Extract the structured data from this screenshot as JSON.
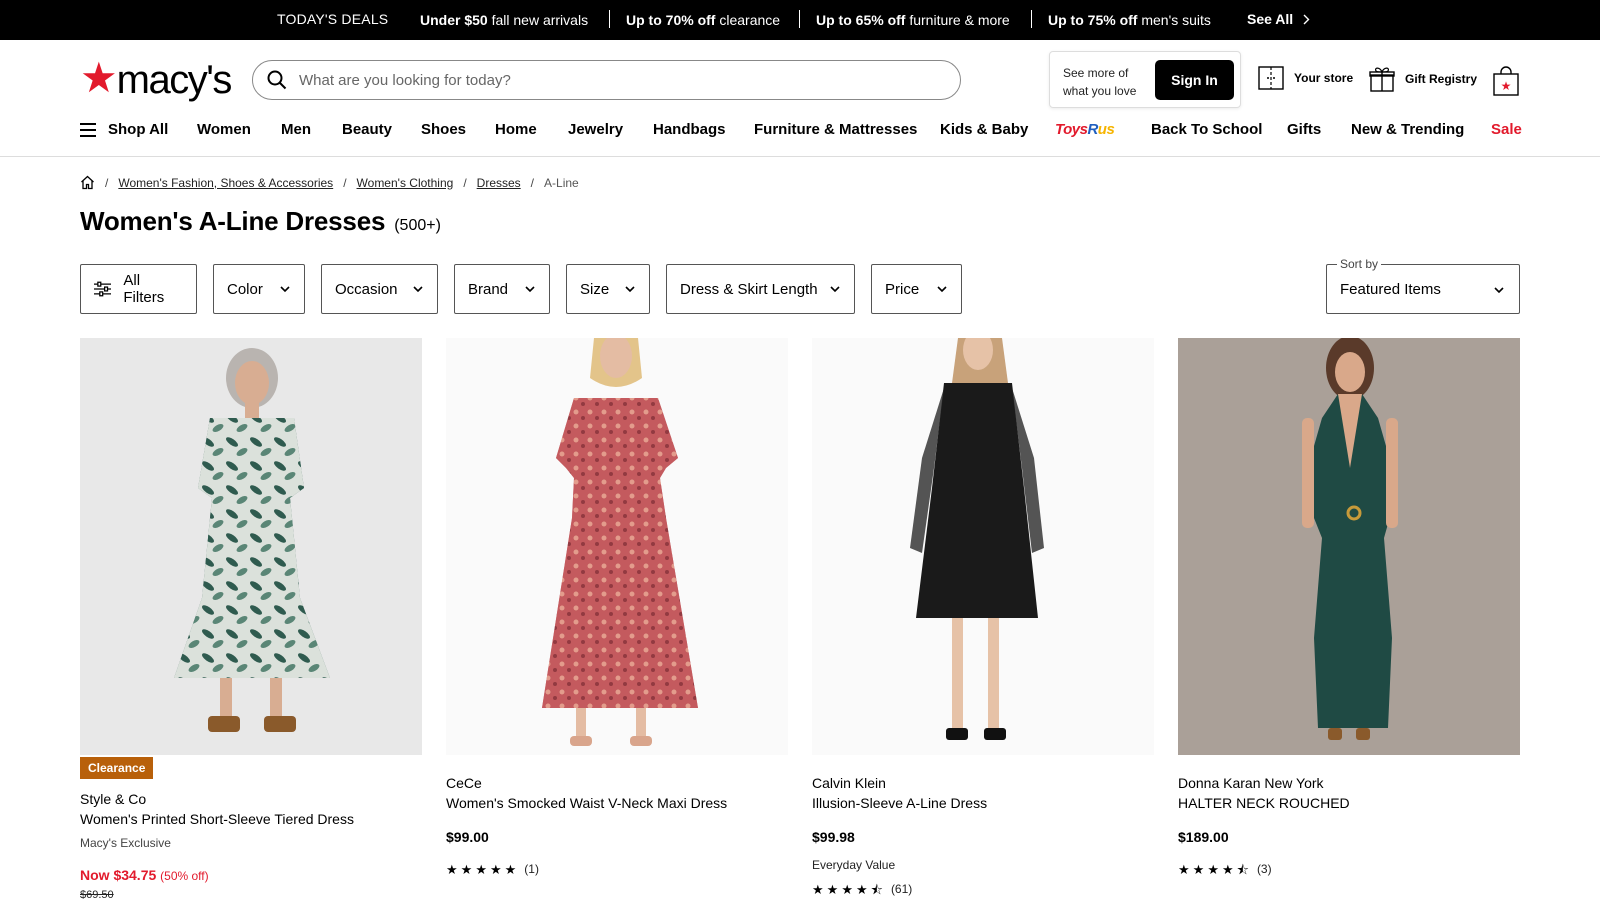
{
  "deals_bar": {
    "label": "TODAY'S DEALS",
    "deals": [
      {
        "bold": "Under $50",
        "rest": " fall new arrivals"
      },
      {
        "bold": "Up to 70% off",
        "rest": " clearance"
      },
      {
        "bold": "Up to 65% off",
        "rest": " furniture & more"
      },
      {
        "bold": "Up to 75% off",
        "rest": " men's suits"
      }
    ],
    "see_all": "See All"
  },
  "header": {
    "logo_text": "macy's",
    "search_placeholder": "What are you looking for today?",
    "see_more": "See more of what you love",
    "sign_in": "Sign In",
    "your_store": "Your store",
    "gift_registry": "Gift Registry"
  },
  "nav": {
    "shop_all": "Shop All",
    "items": [
      "Women",
      "Men",
      "Beauty",
      "Shoes",
      "Home",
      "Jewelry",
      "Handbags",
      "Furniture & Mattresses",
      "Kids & Baby"
    ],
    "toysrus": {
      "a": "Toys",
      "b": "R",
      "c": "us"
    },
    "items2": [
      "Back To School",
      "Gifts",
      "New & Trending",
      "Sale"
    ]
  },
  "breadcrumb": {
    "items": [
      "Women's Fashion, Shoes & Accessories",
      "Women's Clothing",
      "Dresses"
    ],
    "current": "A-Line"
  },
  "page": {
    "title": "Women's A-Line Dresses",
    "count": "(500+)"
  },
  "filters": {
    "all_filters": "All Filters",
    "items": [
      "Color",
      "Occasion",
      "Brand",
      "Size",
      "Dress & Skirt Length",
      "Price"
    ],
    "sort_label": "Sort by",
    "sort_value": "Featured Items"
  },
  "products": [
    {
      "badge": "Clearance",
      "brand": "Style & Co",
      "name": "Women's Printed Short-Sleeve Tiered Dress",
      "sub": "Macy's Exclusive",
      "now": "Now $34.75",
      "pct": "(50% off)",
      "was": "$69.50"
    },
    {
      "brand": "CeCe",
      "name": "Women's Smocked Waist V-Neck Maxi Dress",
      "price": "$99.00",
      "rating": 5,
      "reviews": "(1)"
    },
    {
      "brand": "Calvin Klein",
      "name": "Illusion-Sleeve A-Line Dress",
      "price": "$99.98",
      "sub": "Everyday Value",
      "rating": 4.5,
      "reviews": "(61)"
    },
    {
      "brand": "Donna Karan New York",
      "name": "HALTER NECK ROUCHED",
      "price": "$189.00",
      "rating": 4.5,
      "reviews": "(3)"
    }
  ],
  "colors": {
    "brand_red": "#e21a2c",
    "clearance": "#b8600a"
  }
}
